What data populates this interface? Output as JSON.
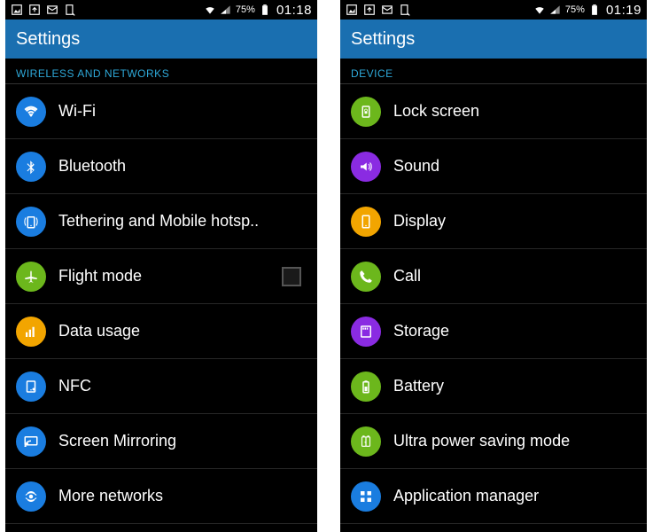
{
  "left": {
    "status": {
      "battery": "75%",
      "time": "01:18"
    },
    "title": "Settings",
    "section": "WIRELESS AND NETWORKS",
    "items": [
      {
        "label": "Wi-Fi",
        "icon": "wifi-icon",
        "bg": "bg-blue"
      },
      {
        "label": "Bluetooth",
        "icon": "bluetooth-icon",
        "bg": "bg-blue"
      },
      {
        "label": "Tethering and Mobile hotsp..",
        "icon": "hotspot-icon",
        "bg": "bg-blue"
      },
      {
        "label": "Flight mode",
        "icon": "airplane-icon",
        "bg": "bg-green",
        "checkbox": true
      },
      {
        "label": "Data usage",
        "icon": "data-usage-icon",
        "bg": "bg-orange"
      },
      {
        "label": "NFC",
        "icon": "nfc-icon",
        "bg": "bg-blue"
      },
      {
        "label": "Screen Mirroring",
        "icon": "mirroring-icon",
        "bg": "bg-blue"
      },
      {
        "label": "More networks",
        "icon": "more-networks-icon",
        "bg": "bg-blue"
      }
    ]
  },
  "right": {
    "status": {
      "battery": "75%",
      "time": "01:19"
    },
    "title": "Settings",
    "section": "DEVICE",
    "items": [
      {
        "label": "Lock screen",
        "icon": "lock-screen-icon",
        "bg": "bg-green"
      },
      {
        "label": "Sound",
        "icon": "sound-icon",
        "bg": "bg-purple"
      },
      {
        "label": "Display",
        "icon": "display-icon",
        "bg": "bg-orange"
      },
      {
        "label": "Call",
        "icon": "call-icon",
        "bg": "bg-green"
      },
      {
        "label": "Storage",
        "icon": "storage-icon",
        "bg": "bg-purple"
      },
      {
        "label": "Battery",
        "icon": "battery-icon",
        "bg": "bg-green"
      },
      {
        "label": "Ultra power saving mode",
        "icon": "power-saving-icon",
        "bg": "bg-green"
      },
      {
        "label": "Application manager",
        "icon": "apps-icon",
        "bg": "bg-blue"
      }
    ]
  }
}
